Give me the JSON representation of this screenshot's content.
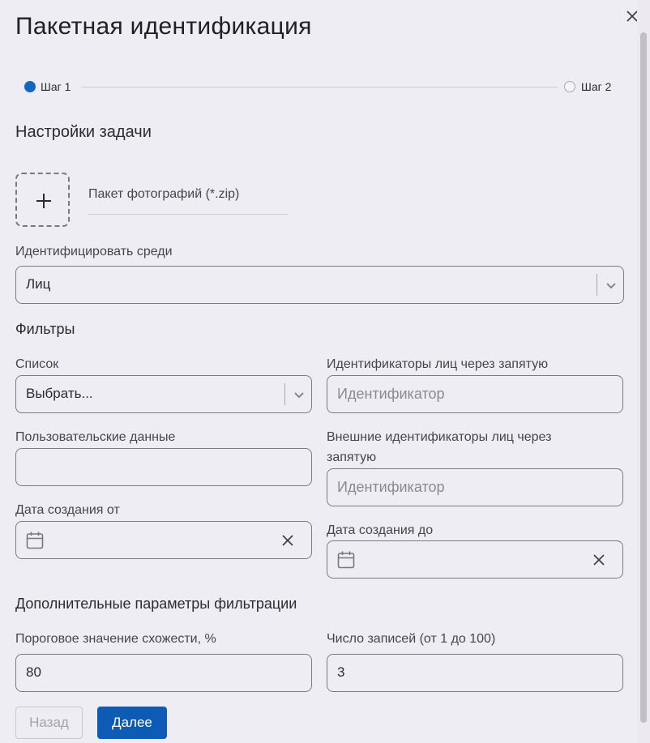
{
  "dialog": {
    "title": "Пакетная идентификация"
  },
  "stepper": {
    "steps": [
      {
        "label": "Шаг 1",
        "state": "active"
      },
      {
        "label": "Шаг 2",
        "state": "inactive"
      }
    ],
    "accent_color": "#1565c0"
  },
  "task_settings": {
    "heading": "Настройки задачи",
    "upload_label": "Пакет фотографий (*.zip)",
    "identify_among_label": "Идентифицировать среди",
    "identify_among_value": "Лиц"
  },
  "filters": {
    "heading": "Фильтры",
    "list_label": "Список",
    "list_value": "Выбрать...",
    "face_ids_label": "Идентификаторы лиц через запятую",
    "face_ids_placeholder": "Идентификатор",
    "user_data_label": "Пользовательские данные",
    "user_data_value": "",
    "external_ids_label_line1": "Внешние идентификаторы лиц через",
    "external_ids_label_line2": "запятую",
    "external_ids_placeholder": "Идентификатор",
    "created_from_label": "Дата создания от",
    "created_to_label": "Дата создания до"
  },
  "additional": {
    "heading": "Дополнительные параметры фильтрации",
    "threshold_label": "Пороговое значение схожести, %",
    "threshold_value": "80",
    "records_label": "Число записей (от 1 до 100)",
    "records_value": "3"
  },
  "footer": {
    "back_label": "Назад",
    "next_label": "Далее",
    "primary_color": "#0d5bb5"
  }
}
